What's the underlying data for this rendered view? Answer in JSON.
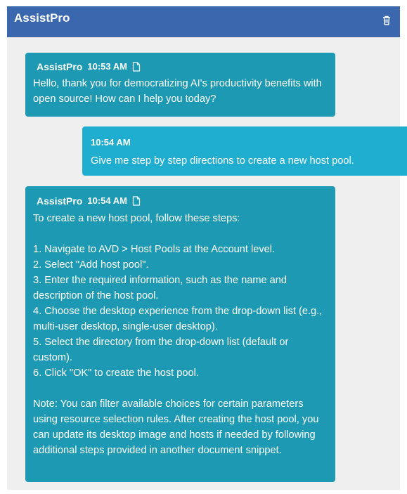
{
  "app": {
    "title": "AssistPro"
  },
  "header": {
    "title": "AssistPro",
    "delete_icon": "trash-icon"
  },
  "colors": {
    "header": "#3a67ad",
    "bot_bubble": "#1e99b3",
    "user_bubble": "#1fadd0",
    "panel": "#efefef"
  },
  "messages": [
    {
      "role": "assistant",
      "sender": "AssistPro",
      "time": "10:53 AM",
      "icon": "document-icon",
      "text": "Hello, thank you for democratizing AI's productivity benefits with open source! How can I help you today?"
    },
    {
      "role": "user",
      "time": "10:54 AM",
      "text": "Give me step by step directions to create a new host pool."
    },
    {
      "role": "assistant",
      "sender": "AssistPro",
      "time": "10:54 AM",
      "icon": "document-icon",
      "text": "To create a new host pool, follow these steps:\n\n1. Navigate to AVD > Host Pools at the Account level.\n2. Select \"Add host pool\".\n3. Enter the required information, such as the name and description of the host pool.\n4. Choose the desktop experience from the drop-down list (e.g., multi-user desktop, single-user desktop).\n5. Select the directory from the drop-down list (default or custom).\n6. Click \"OK\" to create the host pool.\n\nNote: You can filter available choices for certain parameters using resource selection rules. After creating the host pool, you can update its desktop image and hosts if needed by following additional steps provided in another document snippet."
    }
  ]
}
